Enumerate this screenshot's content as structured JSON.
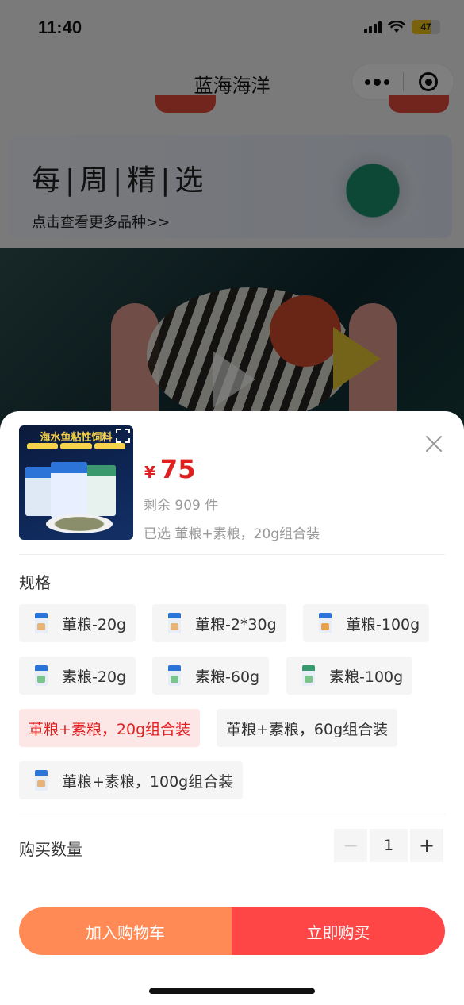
{
  "status_bar": {
    "time": "11:40",
    "battery": "47"
  },
  "nav": {
    "title": "蓝海海洋"
  },
  "banner": {
    "title": "每|周|精|选",
    "subtitle": "点击查看更多品种>>"
  },
  "product": {
    "image_title": "海水鱼粘性饲料",
    "currency": "¥",
    "price": "75",
    "stock_text": "剩余 909 件",
    "selected_text": "已选 莗粮+素粮，20g组合装"
  },
  "spec": {
    "label": "规格",
    "options": [
      {
        "label": "莗粮-20g",
        "selected": false
      },
      {
        "label": "莗粮-2*30g",
        "selected": false
      },
      {
        "label": "莗粮-100g",
        "selected": false
      },
      {
        "label": "素粮-20g",
        "selected": false
      },
      {
        "label": "素粮-60g",
        "selected": false
      },
      {
        "label": "素粮-100g",
        "selected": false
      },
      {
        "label": "莗粮+素粮，20g组合装",
        "selected": true
      },
      {
        "label": "莗粮+素粮，60g组合装",
        "selected": false
      },
      {
        "label": "莗粮+素粮，100g组合装",
        "selected": false
      }
    ]
  },
  "quantity": {
    "label": "购买数量",
    "value": "1",
    "minus": "−",
    "plus": "+"
  },
  "actions": {
    "add_to_cart": "加入购物车",
    "buy_now": "立即购买"
  },
  "colors": {
    "price_red": "#e02020",
    "cart_orange": "#ff8a55",
    "buy_red": "#ff4646",
    "selected_bg": "#fde6e6"
  }
}
